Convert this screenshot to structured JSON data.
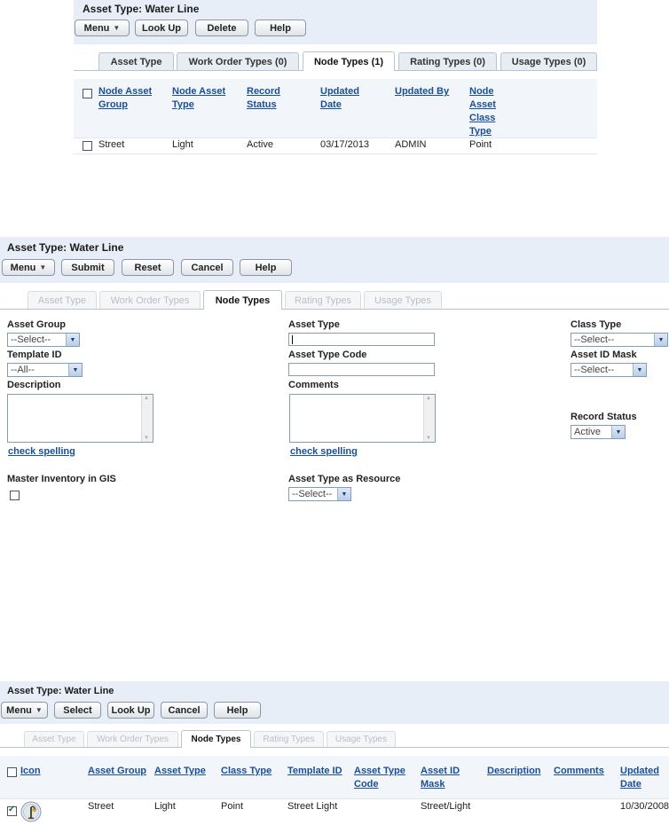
{
  "panel1": {
    "title": "Asset Type: Water Line",
    "buttons": {
      "menu": "Menu",
      "lookup": "Look Up",
      "delete": "Delete",
      "help": "Help"
    },
    "tabs": [
      "Asset Type",
      "Work Order Types (0)",
      "Node Types (1)",
      "Rating Types (0)",
      "Usage Types (0)"
    ],
    "active_tab": "Node Types (1)",
    "columns": [
      "Node Asset\nGroup",
      "Node Asset\nType",
      "Record\nStatus",
      "Updated\nDate",
      "Updated By",
      "Node\nAsset\nClass\nType"
    ],
    "rows": [
      {
        "group": "Street",
        "type": "Light",
        "status": "Active",
        "date": "03/17/2013",
        "by": "ADMIN",
        "class": "Point"
      }
    ]
  },
  "panel2": {
    "title": "Asset Type: Water Line",
    "buttons": {
      "menu": "Menu",
      "submit": "Submit",
      "reset": "Reset",
      "cancel": "Cancel",
      "help": "Help"
    },
    "tabs": [
      "Asset Type",
      "Work Order Types",
      "Node Types",
      "Rating Types",
      "Usage Types"
    ],
    "active_tab": "Node Types",
    "fields": {
      "asset_group_label": "Asset Group",
      "asset_group_value": "--Select--",
      "template_id_label": "Template ID",
      "template_id_value": "--All--",
      "description_label": "Description",
      "check_spelling": "check spelling",
      "master_inventory_label": "Master Inventory in GIS",
      "asset_type_label": "Asset Type",
      "asset_type_value": "",
      "asset_type_code_label": "Asset Type Code",
      "asset_type_code_value": "",
      "comments_label": "Comments",
      "asset_type_resource_label": "Asset Type as Resource",
      "asset_type_resource_value": "--Select--",
      "class_type_label": "Class Type",
      "class_type_value": "--Select--",
      "asset_id_mask_label": "Asset ID Mask",
      "asset_id_mask_value": "--Select--",
      "record_status_label": "Record Status",
      "record_status_value": "Active"
    }
  },
  "panel3": {
    "title": "Asset Type: Water Line",
    "buttons": {
      "menu": "Menu",
      "select": "Select",
      "lookup": "Look Up",
      "cancel": "Cancel",
      "help": "Help"
    },
    "tabs": [
      "Asset Type",
      "Work Order Types",
      "Node Types",
      "Rating Types",
      "Usage Types"
    ],
    "active_tab": "Node Types",
    "columns": [
      "Icon",
      "Asset Group",
      "Asset Type",
      "Class Type",
      "Template ID",
      "Asset Type\nCode",
      "Asset ID\nMask",
      "Description",
      "Comments",
      "Updated\nDate"
    ],
    "rows": [
      {
        "checked": true,
        "icon": "streetlight-icon",
        "group": "Street",
        "type": "Light",
        "class": "Point",
        "template": "Street Light",
        "code": "",
        "mask": "Street/Light",
        "description": "",
        "comments": "",
        "date": "10/30/2008"
      }
    ]
  }
}
